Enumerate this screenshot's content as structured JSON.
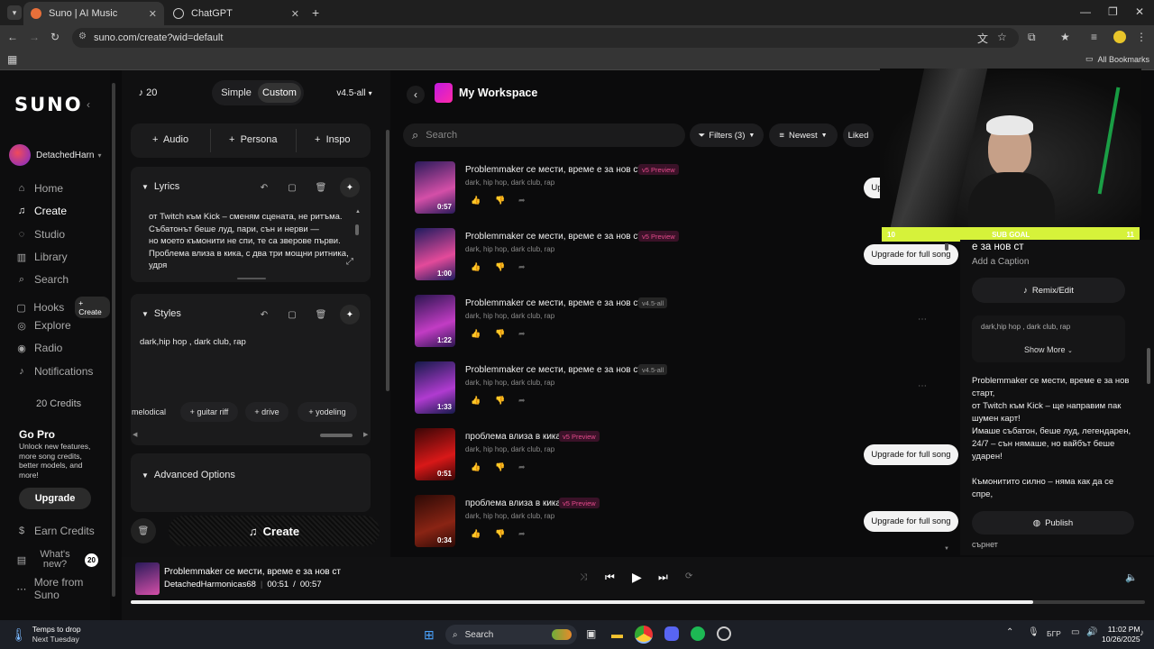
{
  "browser": {
    "tabs": [
      {
        "title": "Suno | AI Music",
        "active": true
      },
      {
        "title": "ChatGPT",
        "active": false
      }
    ],
    "url": "suno.com/create?wid=default",
    "bookmarks_label": "All Bookmarks"
  },
  "sidebar": {
    "logo": "SUNO",
    "username": "DetachedHarn",
    "items": [
      {
        "label": "Home",
        "icon": "home-icon"
      },
      {
        "label": "Create",
        "icon": "create-icon"
      },
      {
        "label": "Studio",
        "icon": "studio-icon"
      },
      {
        "label": "Library",
        "icon": "library-icon"
      },
      {
        "label": "Search",
        "icon": "search-icon"
      },
      {
        "label": "Hooks",
        "icon": "hooks-icon"
      },
      {
        "label": "Explore",
        "icon": "explore-icon"
      },
      {
        "label": "Radio",
        "icon": "radio-icon"
      },
      {
        "label": "Notifications",
        "icon": "bell-icon"
      }
    ],
    "hooks_create": "+ Create",
    "credits": "20 Credits",
    "gopro_title": "Go Pro",
    "gopro_text": "Unlock new features, more song credits, better models, and more!",
    "upgrade": "Upgrade",
    "earn_credits": "Earn Credits",
    "whats_new": "What's new?",
    "whats_new_count": "20",
    "more_from_suno": "More from Suno"
  },
  "create": {
    "credit_count": "20",
    "mode_simple": "Simple",
    "mode_custom": "Custom",
    "model": "v4.5-all",
    "add_audio": "Audio",
    "add_persona": "Persona",
    "add_inspo": "Inspo",
    "lyrics_label": "Lyrics",
    "lyrics_lines": [
      "от Twitch към Kick – сменям сцената, не ритъма.",
      "Събатонът беше луд, пари, сън и нерви —",
      "но моето къмонити не спи, те са зверове първи.",
      "Проблема влиза в кика, с два три мощни ритника,",
      "удря"
    ],
    "styles_label": "Styles",
    "styles_value": "dark,hip hop , dark club, rap",
    "style_chips": [
      "melodical",
      "guitar riff",
      "drive",
      "yodeling"
    ],
    "advanced": "Advanced Options",
    "create_button": "Create"
  },
  "workspace": {
    "title": "My Workspace",
    "search_placeholder": "Search",
    "filters": "Filters (3)",
    "sort": "Newest",
    "liked": "Liked",
    "songs": [
      {
        "title": "Problemmaker се мести, време е за нов ст",
        "badge": "v5 Preview",
        "badge_type": "v5",
        "tags": "dark, hip hop, dark club, rap",
        "duration": "0:57",
        "upgrade": "Upgrade for full song",
        "color1": "#2a1a5a",
        "color2": "#d44fa8"
      },
      {
        "title": "Problemmaker се мести, време е за нов ст",
        "badge": "v5 Preview",
        "badge_type": "v5",
        "tags": "dark, hip hop, dark club, rap",
        "duration": "1:00",
        "upgrade": "Upgrade for full song",
        "color1": "#1d1b5e",
        "color2": "#e34a9a"
      },
      {
        "title": "Problemmaker се мести, време е за нов ст",
        "badge": "v4.5-all",
        "badge_type": "v45",
        "tags": "dark, hip hop, dark club, rap",
        "duration": "1:22",
        "upgrade": "",
        "color1": "#2b1550",
        "color2": "#c23cc4"
      },
      {
        "title": "Problemmaker се мести, време е за нов ст",
        "badge": "v4.5-all",
        "badge_type": "v45",
        "tags": "dark, hip hop, dark club, rap",
        "duration": "1:33",
        "upgrade": "",
        "color1": "#151a4a",
        "color2": "#b03bd0"
      },
      {
        "title": "проблема влиза в кика",
        "badge": "v5 Preview",
        "badge_type": "v5",
        "tags": "dark, hip hop, dark club, rap",
        "duration": "0:51",
        "upgrade": "Upgrade for full song",
        "color1": "#3a0606",
        "color2": "#d81818"
      },
      {
        "title": "проблема влиза в кика",
        "badge": "v5 Preview",
        "badge_type": "v5",
        "tags": "dark, hip hop, dark club, rap",
        "duration": "0:34",
        "upgrade": "Upgrade for full song",
        "color1": "#2c0a06",
        "color2": "#8a2414"
      }
    ]
  },
  "details": {
    "title_fragment": "е за нов ст",
    "caption": "Add a Caption",
    "remix": "Remix/Edit",
    "tags": "dark,hip hop , dark club, rap",
    "show_more": "Show More",
    "lyrics": [
      "Problemmaker се мести, време е за нов",
      "старт,",
      "от Twitch към Kick – ще направим пак",
      "шумен карт!",
      "Имаше събатон, беше луд, легендарен,",
      "24/7 – сън нямаше, но вайбът беше",
      "ударен!",
      "",
      "Къмонитито силно – няма как да се",
      "спре,"
    ],
    "publish": "Publish",
    "trailing": "сърнет"
  },
  "webcam": {
    "goal_left": "10",
    "goal_label": "SUB GOAL",
    "goal_right": "11"
  },
  "player": {
    "title": "Problemmaker се мести, време е за нов ст",
    "artist": "DetachedHarmonicas68",
    "current": "00:51",
    "separator": "/",
    "total": "00:57",
    "progress": 0.89
  },
  "taskbar": {
    "weather_title": "Temps to drop",
    "weather_sub": "Next Tuesday",
    "search": "Search",
    "lang": "БГР",
    "time": "11:02 PM",
    "date": "10/26/2025"
  },
  "colors": {
    "accent_pink": "#e44a8b",
    "goal_yellow": "#d6f23a"
  }
}
